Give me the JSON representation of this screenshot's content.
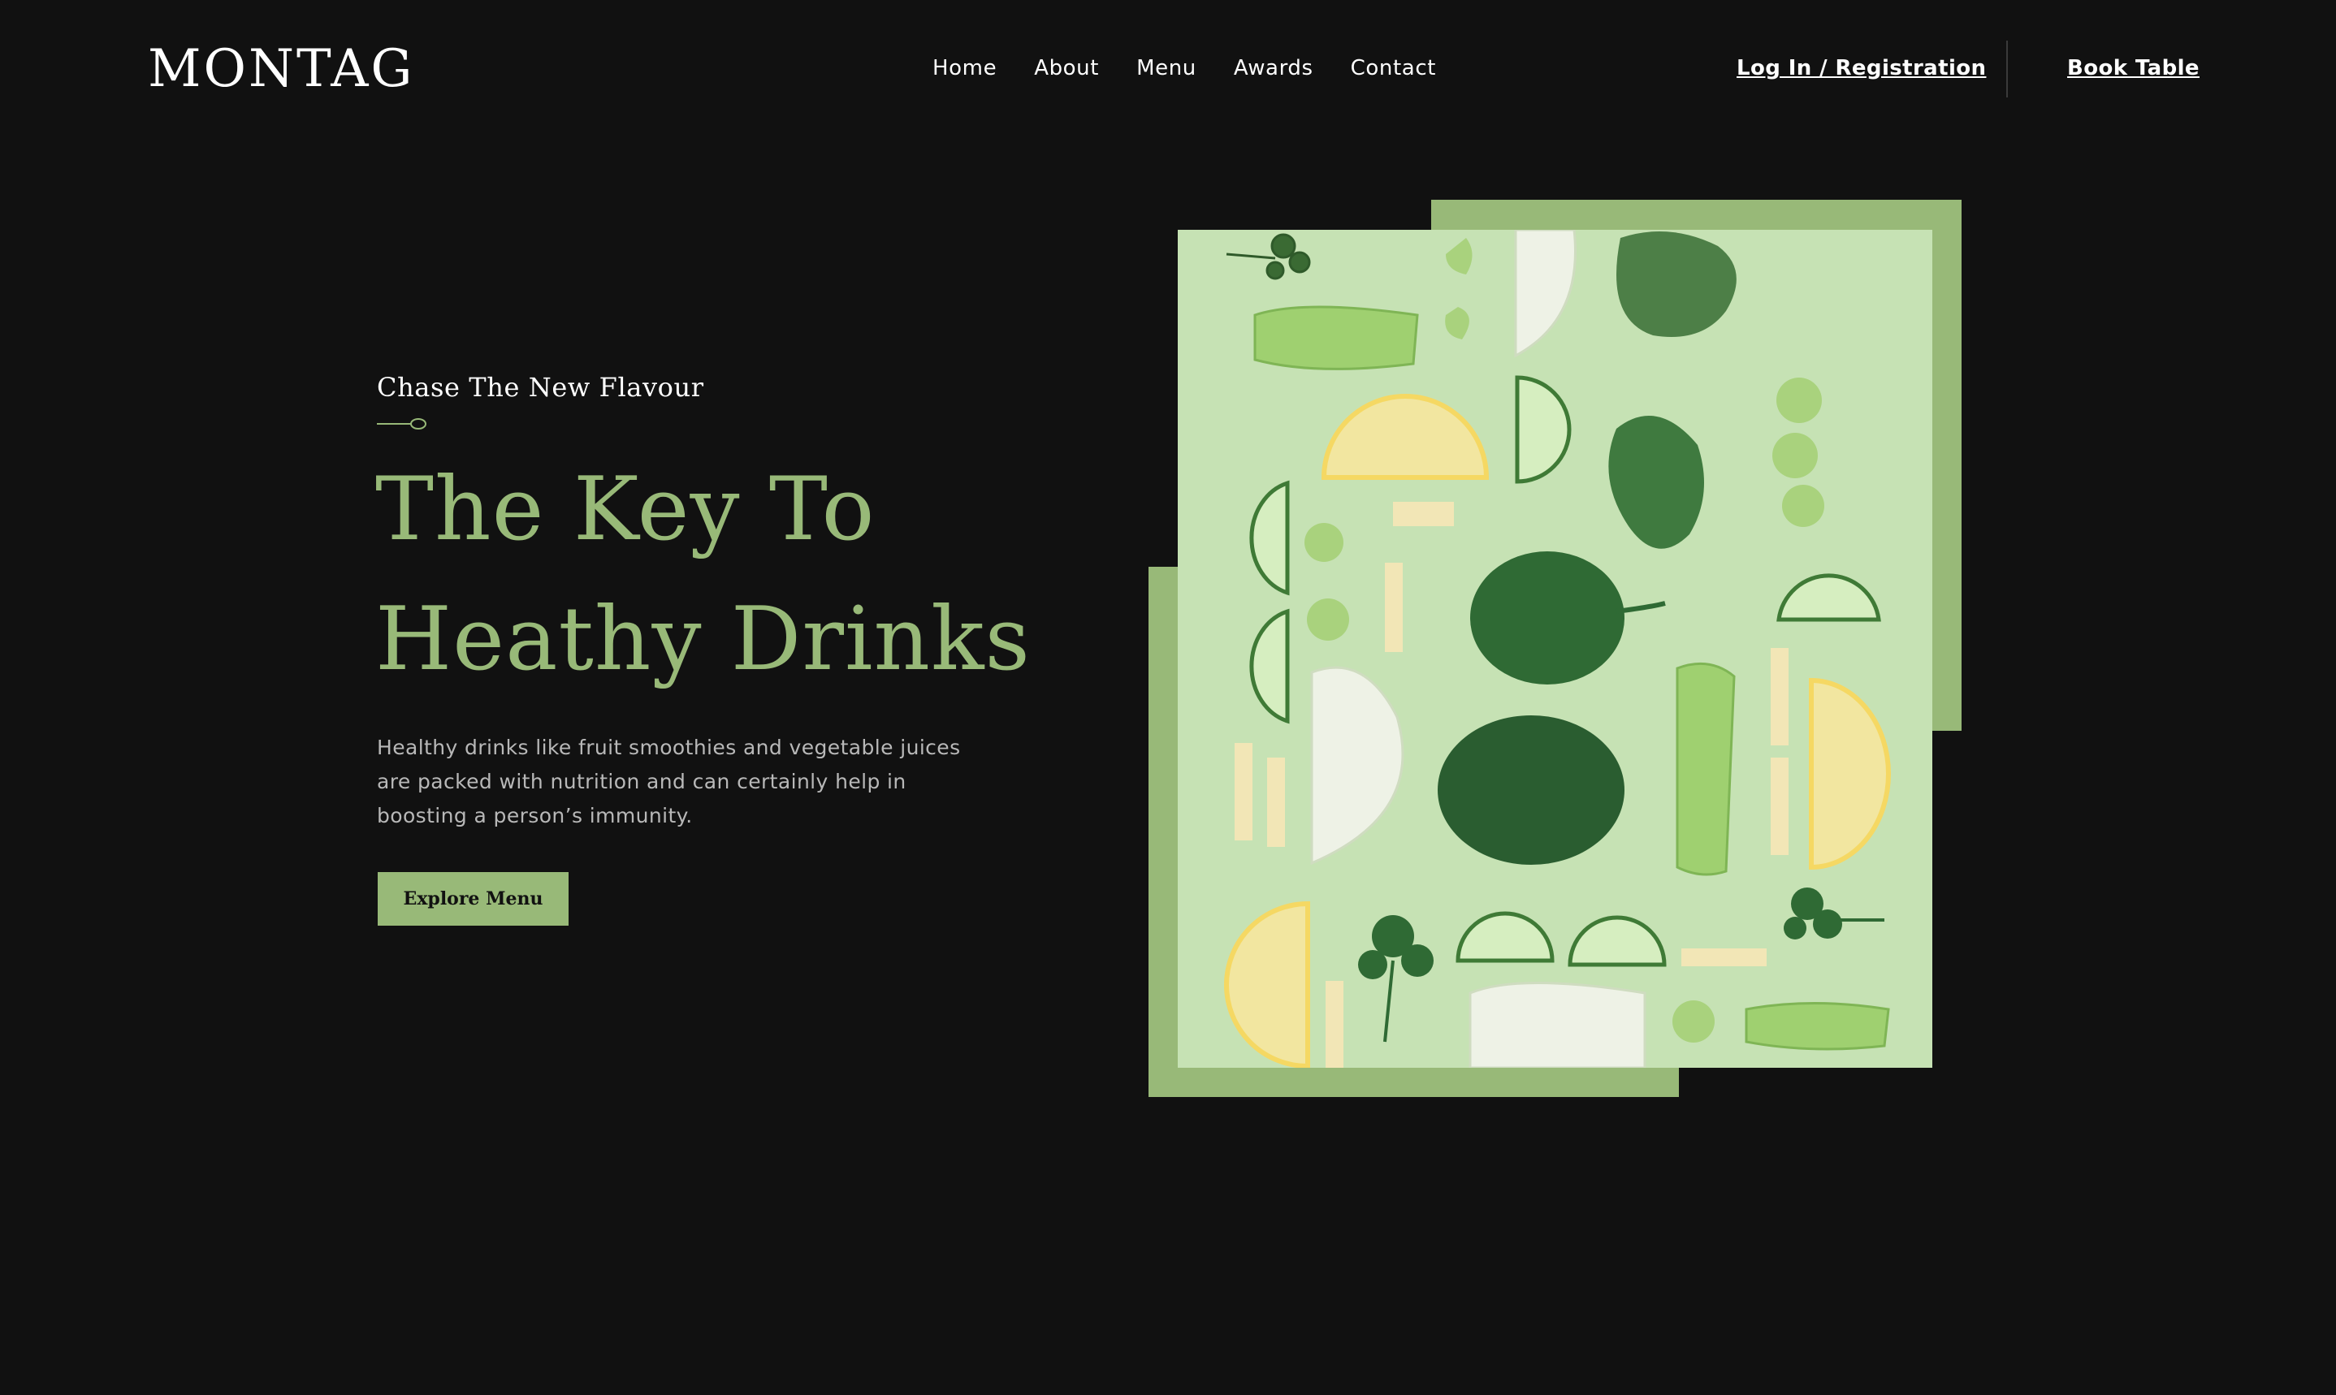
{
  "header": {
    "logo": "MONTAG",
    "nav": [
      "Home",
      "About",
      "Menu",
      "Awards",
      "Contact"
    ],
    "login_label": "Log In / Registration",
    "book_label": "Book Table"
  },
  "hero": {
    "kicker": "Chase The New Flavour",
    "headline_line1": "The Key To",
    "headline_line2": "Heathy Drinks",
    "description": "Healthy drinks like fruit smoothies and vegetable juices are packed with nutrition and can certainly help in boosting a person’s immunity.",
    "cta_label": "Explore Menu"
  },
  "colors": {
    "background": "#111111",
    "accent": "#98b978",
    "photo_background": "#c6e2b4",
    "text": "#ffffff",
    "muted_text": "#b8b8b8"
  },
  "icons": {
    "kicker_divider": "spoon-icon"
  }
}
